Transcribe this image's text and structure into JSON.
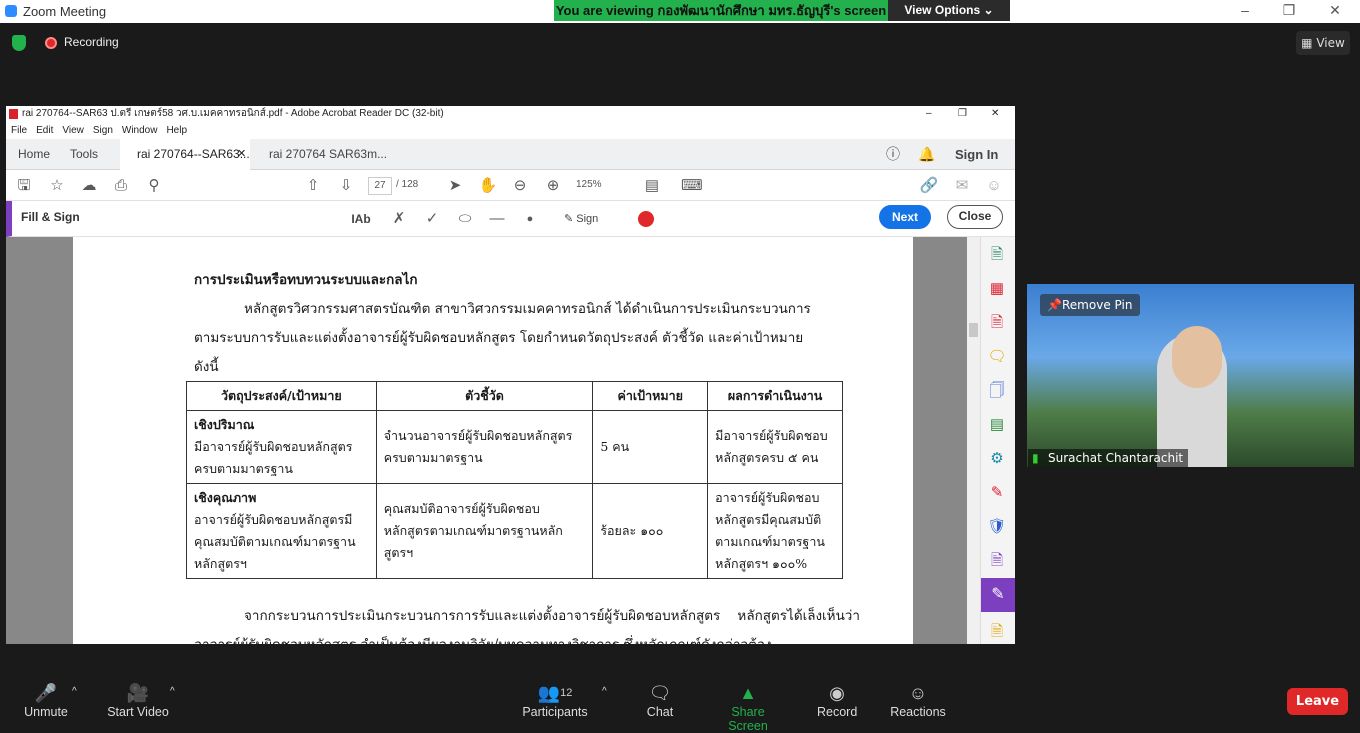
{
  "zoom": {
    "window_title": "Zoom Meeting",
    "banner_text": "You are viewing กองพัฒนานักศึกษา มทร.ธัญบุรี's screen",
    "view_options": "View Options",
    "recording_label": "Recording",
    "view_label": "View",
    "video": {
      "participant_name": "Surachat Chantarachit",
      "remove_pin": "Remove Pin"
    },
    "toolbar": {
      "unmute": "Unmute",
      "start_video": "Start Video",
      "participants": "Participants",
      "participants_count": "12",
      "chat": "Chat",
      "share_screen": "Share Screen",
      "record": "Record",
      "reactions": "Reactions",
      "leave": "Leave"
    },
    "colors": {
      "share_green": "#23b14d",
      "leave_red": "#e02828",
      "accent": "#2d8cff"
    }
  },
  "acrobat": {
    "window_title": "rai 270764--SAR63 ป.ตรี เกษตร์58 วศ.บ.เมคคาทรอนิกส์.pdf - Adobe Acrobat Reader DC (32-bit)",
    "menu": [
      "File",
      "Edit",
      "View",
      "Sign",
      "Window",
      "Help"
    ],
    "tabs": {
      "home": "Home",
      "tools": "Tools",
      "doc1": "rai 270764--SAR63...",
      "doc2": "rai 270764 SAR63m..."
    },
    "sign_in": "Sign In",
    "page_current": "27",
    "page_total": "/ 128",
    "zoom_level": "125%",
    "fill_sign": "Fill & Sign",
    "sign_label": "Sign",
    "next": "Next",
    "close": "Close"
  },
  "document": {
    "heading": "การประเมินหรือทบทวนระบบและกลไก",
    "para1_line1": "หลักสูตรวิศวกรรมศาสตรบัณฑิต สาขาวิศวกรรมเมคคาทรอนิกส์ ได้ดำเนินการประเมินกระบวนการ",
    "para1_line2": "ตามระบบการรับและแต่งตั้งอาจารย์ผู้รับผิดชอบหลักสูตร โดยกำหนดวัตถุประสงค์ ตัวชี้วัด และค่าเป้าหมาย",
    "para1_line3": "ดังนี้",
    "table_headers": [
      "วัตถุประสงค์/เป้าหมาย",
      "ตัวชี้วัด",
      "ค่าเป้าหมาย",
      "ผลการดำเนินงาน"
    ],
    "row1": {
      "label": "เชิงปริมาณ",
      "objective": "มีอาจารย์ผู้รับผิดชอบหลักสูตรครบตามมาตรฐาน",
      "indicator": "จำนวนอาจารย์ผู้รับผิดชอบหลักสูตรครบตามมาตรฐาน",
      "target": "5 คน",
      "result": "มีอาจารย์ผู้รับผิดชอบหลักสูตรครบ ๕ คน"
    },
    "row2": {
      "label": "เชิงคุณภาพ",
      "objective": "อาจารย์ผู้รับผิดชอบหลักสูตรมีคุณสมบัติตามเกณฑ์มาตรฐานหลักสูตรฯ",
      "indicator": "คุณสมบัติอาจารย์ผู้รับผิดชอบหลักสูตรตามเกณฑ์มาตรฐานหลักสูตรฯ",
      "target": "ร้อยละ ๑๐๐",
      "result": "อาจารย์ผู้รับผิดชอบหลักสูตรมีคุณสมบัติตามเกณฑ์มาตรฐานหลักสูตรฯ ๑๐๐%"
    },
    "para2_line1": "จากกระบวนการประเมินกระบวนการการรับและแต่งตั้งอาจารย์ผู้รับผิดชอบหลักสูตร    หลักสูตรได้เล็งเห็นว่า",
    "para2_line2": "อาจารย์ผู้รับผิดชอบหลักสูตร จำเป็นต้องมีผลงานวิจัย/บทความทางวิชาการ ซึ่งหลักเกณฑ์ดังกล่าวต้อง"
  }
}
